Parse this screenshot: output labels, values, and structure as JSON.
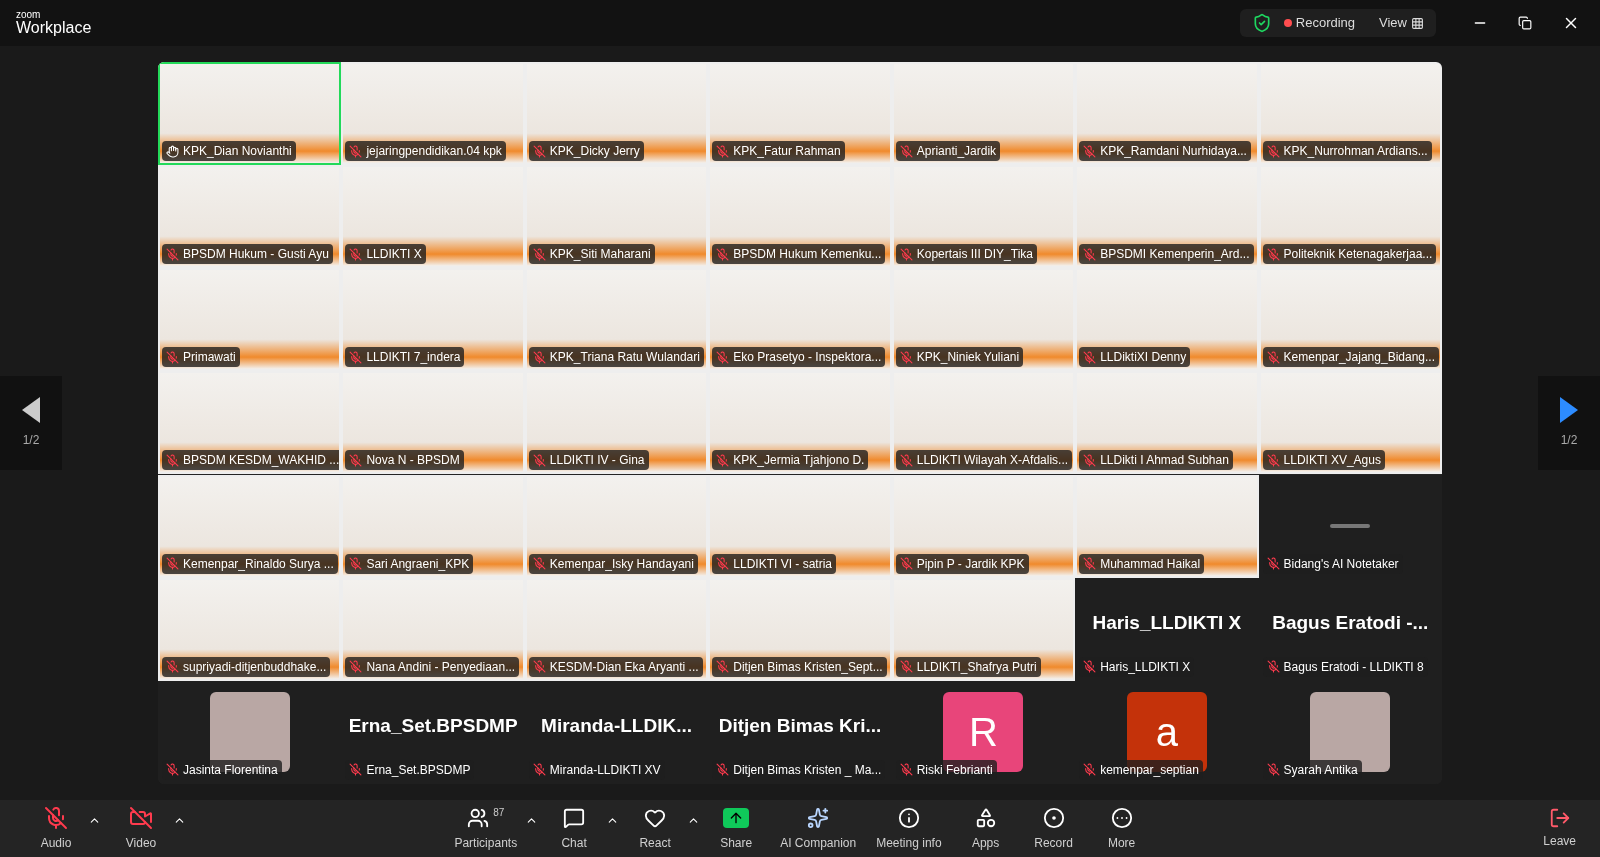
{
  "titlebar": {
    "brand_top": "zoom",
    "brand": "Workplace",
    "recording": "Recording",
    "recording_on": true,
    "view": "View"
  },
  "pager": {
    "left": "1/2",
    "right": "1/2"
  },
  "tiles": [
    {
      "name": "KPK_Dian Novianthi",
      "kind": "video",
      "speaking": true,
      "muted": false
    },
    {
      "name": "jejaringpendidikan.04 kpk",
      "kind": "video",
      "speaking": false,
      "muted": true
    },
    {
      "name": "KPK_Dicky Jerry",
      "kind": "video",
      "speaking": false,
      "muted": true
    },
    {
      "name": "KPK_Fatur Rahman",
      "kind": "video",
      "speaking": false,
      "muted": true
    },
    {
      "name": "Aprianti_Jardik",
      "kind": "video",
      "speaking": false,
      "muted": true
    },
    {
      "name": "KPK_Ramdani Nurhidaya...",
      "kind": "video",
      "speaking": false,
      "muted": true
    },
    {
      "name": "KPK_Nurrohman Ardians...",
      "kind": "video",
      "speaking": false,
      "muted": true
    },
    {
      "name": "BPSDM Hukum - Gusti Ayu",
      "kind": "video",
      "speaking": false,
      "muted": true
    },
    {
      "name": "LLDIKTI X",
      "kind": "video",
      "speaking": false,
      "muted": true
    },
    {
      "name": "KPK_Siti Maharani",
      "kind": "video",
      "speaking": false,
      "muted": true
    },
    {
      "name": "BPSDM Hukum Kemenku...",
      "kind": "video",
      "speaking": false,
      "muted": true
    },
    {
      "name": "Kopertais III DIY_Tika",
      "kind": "video",
      "speaking": false,
      "muted": true
    },
    {
      "name": "BPSDMI Kemenperin_Ard...",
      "kind": "video",
      "speaking": false,
      "muted": true
    },
    {
      "name": "Politeknik Ketenagakerjaa...",
      "kind": "video",
      "speaking": false,
      "muted": true
    },
    {
      "name": "Primawati",
      "kind": "video",
      "speaking": false,
      "muted": true
    },
    {
      "name": "LLDIKTI 7_indera",
      "kind": "video",
      "speaking": false,
      "muted": true
    },
    {
      "name": "KPK_Triana Ratu Wulandari",
      "kind": "video",
      "speaking": false,
      "muted": true
    },
    {
      "name": "Eko Prasetyo - Inspektora...",
      "kind": "video",
      "speaking": false,
      "muted": true
    },
    {
      "name": "KPK_Niniek Yuliani",
      "kind": "video",
      "speaking": false,
      "muted": true
    },
    {
      "name": "LLDiktiXI Denny",
      "kind": "video",
      "speaking": false,
      "muted": true
    },
    {
      "name": "Kemenpar_Jajang_Bidang...",
      "kind": "video",
      "speaking": false,
      "muted": true
    },
    {
      "name": "BPSDM KESDM_WAKHID ...",
      "kind": "video",
      "speaking": false,
      "muted": true
    },
    {
      "name": "Nova N - BPSDM",
      "kind": "video",
      "speaking": false,
      "muted": true
    },
    {
      "name": "LLDIKTI IV - Gina",
      "kind": "video",
      "speaking": false,
      "muted": true
    },
    {
      "name": "KPK_Jermia Tjahjono D.",
      "kind": "video",
      "speaking": false,
      "muted": true
    },
    {
      "name": "LLDIKTI Wilayah X-Afdalis...",
      "kind": "video",
      "speaking": false,
      "muted": true
    },
    {
      "name": "LLDikti I Ahmad Subhan",
      "kind": "video",
      "speaking": false,
      "muted": true
    },
    {
      "name": "LLDIKTI XV_Agus",
      "kind": "video",
      "speaking": false,
      "muted": true
    },
    {
      "name": "Kemenpar_Rinaldo Surya ...",
      "kind": "video",
      "speaking": false,
      "muted": true
    },
    {
      "name": "Sari Angraeni_KPK",
      "kind": "video",
      "speaking": false,
      "muted": true
    },
    {
      "name": "Kemenpar_Isky Handayani",
      "kind": "video",
      "speaking": false,
      "muted": true
    },
    {
      "name": "LLDIKTI VI - satria",
      "kind": "video",
      "speaking": false,
      "muted": true
    },
    {
      "name": "Pipin P - Jardik KPK",
      "kind": "video",
      "speaking": false,
      "muted": true
    },
    {
      "name": "Muhammad Haikal",
      "kind": "video",
      "speaking": false,
      "muted": true
    },
    {
      "name": "Bidang's AI Notetaker",
      "kind": "dark",
      "speaking": false,
      "muted": true
    },
    {
      "name": "supriyadi-ditjenbuddhake...",
      "kind": "video",
      "speaking": false,
      "muted": true
    },
    {
      "name": "Nana Andini - Penyediaan...",
      "kind": "video",
      "speaking": false,
      "muted": true
    },
    {
      "name": "KESDM-Dian Eka Aryanti ...",
      "kind": "video",
      "speaking": false,
      "muted": true
    },
    {
      "name": "Ditjen Bimas Kristen_Sept...",
      "kind": "video",
      "speaking": false,
      "muted": true
    },
    {
      "name": "LLDIKTI_Shafrya Putri",
      "kind": "video",
      "speaking": false,
      "muted": true
    },
    {
      "name": "Haris_LLDIKTI X",
      "kind": "name",
      "display": "Haris_LLDIKTI X",
      "speaking": false,
      "muted": true
    },
    {
      "name": "Bagus Eratodi - LLDIKTI 8",
      "kind": "name",
      "display": "Bagus Eratodi -...",
      "speaking": false,
      "muted": true
    },
    {
      "name": "Jasinta Florentina",
      "kind": "photo",
      "speaking": false,
      "muted": true
    },
    {
      "name": "Erna_Set.BPSDMP",
      "kind": "name",
      "display": "Erna_Set.BPSDMP",
      "speaking": false,
      "muted": true
    },
    {
      "name": "Miranda-LLDIKTI XV",
      "kind": "name",
      "display": "Miranda-LLDIK...",
      "speaking": false,
      "muted": true
    },
    {
      "name": "Ditjen Bimas Kristen _ Ma...",
      "kind": "name",
      "display": "Ditjen Bimas Kri...",
      "speaking": false,
      "muted": true
    },
    {
      "name": "Riski Febrianti",
      "kind": "letter",
      "letter": "R",
      "color": "#e8457a",
      "speaking": false,
      "muted": true
    },
    {
      "name": "kemenpar_septian",
      "kind": "letter",
      "letter": "a",
      "color": "#c4320a",
      "speaking": false,
      "muted": true
    },
    {
      "name": "Syarah Antika",
      "kind": "photo",
      "speaking": false,
      "muted": true
    }
  ],
  "toolbar": {
    "left": [
      {
        "kind": "audio",
        "label": "Audio",
        "off": true,
        "caret": true
      },
      {
        "kind": "video",
        "label": "Video",
        "off": true,
        "caret": true
      }
    ],
    "center": [
      {
        "kind": "participants",
        "label": "Participants",
        "count": "87",
        "caret": true
      },
      {
        "kind": "chat",
        "label": "Chat",
        "caret": true
      },
      {
        "kind": "react",
        "label": "React",
        "caret": true
      },
      {
        "kind": "share",
        "label": "Share",
        "caret": false
      },
      {
        "kind": "ai",
        "label": "AI Companion",
        "caret": false
      },
      {
        "kind": "info",
        "label": "Meeting info",
        "caret": false
      },
      {
        "kind": "apps",
        "label": "Apps",
        "caret": false
      },
      {
        "kind": "record",
        "label": "Record",
        "caret": false
      },
      {
        "kind": "more",
        "label": "More",
        "caret": false
      }
    ],
    "leave": {
      "label": "Leave"
    }
  }
}
